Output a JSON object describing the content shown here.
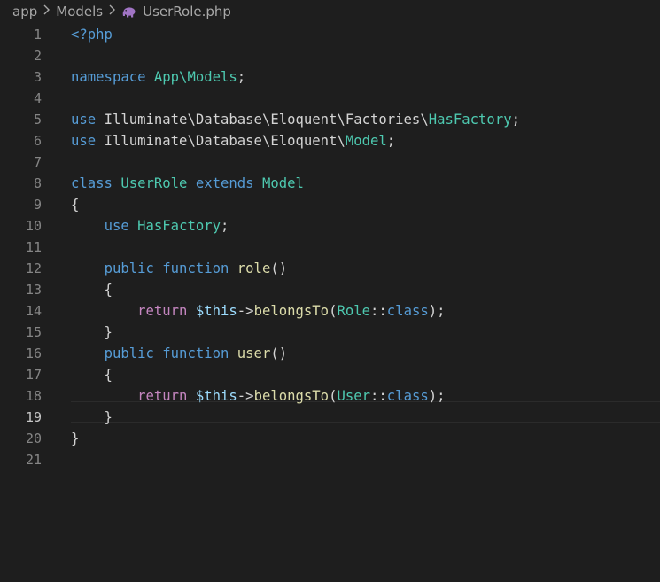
{
  "breadcrumb": {
    "segments": [
      "app",
      "Models"
    ],
    "file": "UserRole.php",
    "file_icon": "php-elephant-icon"
  },
  "editor": {
    "active_line": 19,
    "lines": [
      {
        "n": "1",
        "tokens": [
          {
            "t": "<?php",
            "c": "k"
          }
        ]
      },
      {
        "n": "2",
        "tokens": []
      },
      {
        "n": "3",
        "tokens": [
          {
            "t": "namespace ",
            "c": "k"
          },
          {
            "t": "App\\Models",
            "c": "t"
          },
          {
            "t": ";",
            "c": "p"
          }
        ]
      },
      {
        "n": "4",
        "tokens": []
      },
      {
        "n": "5",
        "tokens": [
          {
            "t": "use ",
            "c": "k"
          },
          {
            "t": "Illuminate\\Database\\Eloquent\\Factories\\",
            "c": "p"
          },
          {
            "t": "HasFactory",
            "c": "t"
          },
          {
            "t": ";",
            "c": "p"
          }
        ]
      },
      {
        "n": "6",
        "tokens": [
          {
            "t": "use ",
            "c": "k"
          },
          {
            "t": "Illuminate\\Database\\Eloquent\\",
            "c": "p"
          },
          {
            "t": "Model",
            "c": "t"
          },
          {
            "t": ";",
            "c": "p"
          }
        ]
      },
      {
        "n": "7",
        "tokens": []
      },
      {
        "n": "8",
        "tokens": [
          {
            "t": "class ",
            "c": "k"
          },
          {
            "t": "UserRole",
            "c": "t"
          },
          {
            "t": " ",
            "c": "p"
          },
          {
            "t": "extends",
            "c": "k"
          },
          {
            "t": " ",
            "c": "p"
          },
          {
            "t": "Model",
            "c": "t"
          }
        ]
      },
      {
        "n": "9",
        "tokens": [
          {
            "t": "{",
            "c": "p"
          }
        ]
      },
      {
        "n": "10",
        "tokens": [
          {
            "t": "    ",
            "c": "p"
          },
          {
            "t": "use ",
            "c": "k"
          },
          {
            "t": "HasFactory",
            "c": "t"
          },
          {
            "t": ";",
            "c": "p"
          }
        ]
      },
      {
        "n": "11",
        "tokens": []
      },
      {
        "n": "12",
        "tokens": [
          {
            "t": "    ",
            "c": "p"
          },
          {
            "t": "public ",
            "c": "k"
          },
          {
            "t": "function ",
            "c": "k"
          },
          {
            "t": "role",
            "c": "f"
          },
          {
            "t": "()",
            "c": "p"
          }
        ]
      },
      {
        "n": "13",
        "tokens": [
          {
            "t": "    {",
            "c": "p"
          }
        ]
      },
      {
        "n": "14",
        "tokens": [
          {
            "t": "        ",
            "c": "p"
          },
          {
            "t": "return ",
            "c": "c"
          },
          {
            "t": "$this",
            "c": "v"
          },
          {
            "t": "->",
            "c": "p"
          },
          {
            "t": "belongsTo",
            "c": "f"
          },
          {
            "t": "(",
            "c": "p"
          },
          {
            "t": "Role",
            "c": "t"
          },
          {
            "t": "::",
            "c": "p"
          },
          {
            "t": "class",
            "c": "k"
          },
          {
            "t": ");",
            "c": "p"
          }
        ]
      },
      {
        "n": "15",
        "tokens": [
          {
            "t": "    }",
            "c": "p"
          }
        ]
      },
      {
        "n": "16",
        "tokens": [
          {
            "t": "    ",
            "c": "p"
          },
          {
            "t": "public ",
            "c": "k"
          },
          {
            "t": "function ",
            "c": "k"
          },
          {
            "t": "user",
            "c": "f"
          },
          {
            "t": "()",
            "c": "p"
          }
        ]
      },
      {
        "n": "17",
        "tokens": [
          {
            "t": "    {",
            "c": "p"
          }
        ]
      },
      {
        "n": "18",
        "tokens": [
          {
            "t": "        ",
            "c": "p"
          },
          {
            "t": "return ",
            "c": "c"
          },
          {
            "t": "$this",
            "c": "v"
          },
          {
            "t": "->",
            "c": "p"
          },
          {
            "t": "belongsTo",
            "c": "f"
          },
          {
            "t": "(",
            "c": "p"
          },
          {
            "t": "User",
            "c": "t"
          },
          {
            "t": "::",
            "c": "p"
          },
          {
            "t": "class",
            "c": "k"
          },
          {
            "t": ");",
            "c": "p"
          }
        ]
      },
      {
        "n": "19",
        "tokens": [
          {
            "t": "    }",
            "c": "p"
          }
        ]
      },
      {
        "n": "20",
        "tokens": [
          {
            "t": "}",
            "c": "p"
          }
        ]
      },
      {
        "n": "21",
        "tokens": []
      }
    ]
  }
}
